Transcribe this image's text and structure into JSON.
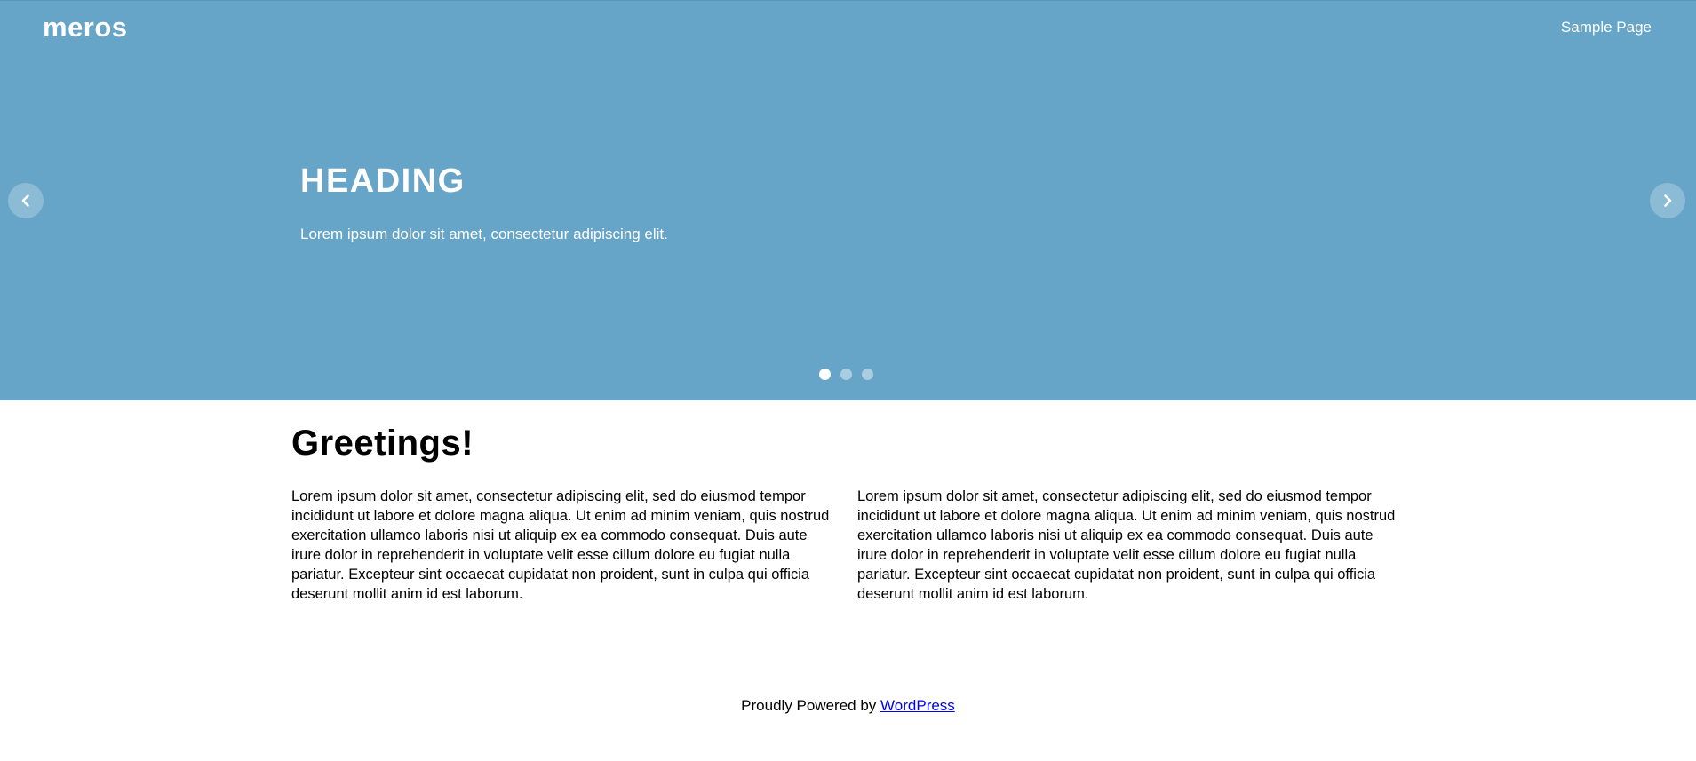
{
  "header": {
    "logo": "meros",
    "nav": [
      "Sample Page"
    ]
  },
  "slider": {
    "heading": "HEADING",
    "text": "Lorem ipsum dolor sit amet, consectetur adipiscing elit.",
    "prev_icon": "chevron-left-icon",
    "next_icon": "chevron-right-icon",
    "slide_count": 3,
    "active_slide": 1,
    "background_color": "#66a4c8"
  },
  "main": {
    "title": "Greetings!",
    "columns": [
      "Lorem ipsum dolor sit amet, consectetur adipiscing elit, sed do eiusmod tempor incididunt ut labore et dolore magna aliqua. Ut enim ad minim veniam, quis nostrud exercitation ullamco laboris nisi ut aliquip ex ea commodo consequat. Duis aute irure dolor in reprehenderit in voluptate velit esse cillum dolore eu fugiat nulla pariatur. Excepteur sint occaecat cupidatat non proident, sunt in culpa qui officia deserunt mollit anim id est laborum.",
      "Lorem ipsum dolor sit amet, consectetur adipiscing elit, sed do eiusmod tempor incididunt ut labore et dolore magna aliqua. Ut enim ad minim veniam, quis nostrud exercitation ullamco laboris nisi ut aliquip ex ea commodo consequat. Duis aute irure dolor in reprehenderit in voluptate velit esse cillum dolore eu fugiat nulla pariatur. Excepteur sint occaecat cupidatat non proident, sunt in culpa qui officia deserunt mollit anim id est laborum."
    ]
  },
  "footer": {
    "text": "Proudly Powered by",
    "link_label": "WordPress",
    "link_color": "#0000ee"
  }
}
